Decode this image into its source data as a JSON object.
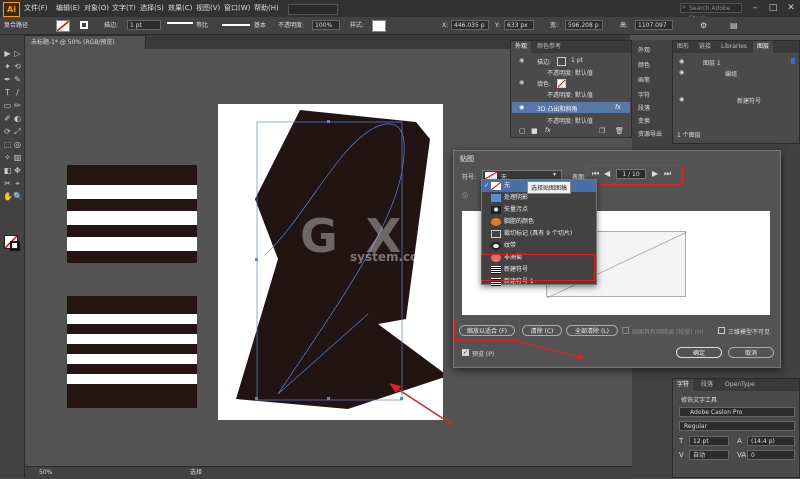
{
  "app": {
    "logo": "Ai"
  },
  "menu": [
    "文件(F)",
    "编辑(E)",
    "对象(O)",
    "文字(T)",
    "选择(S)",
    "效果(C)",
    "视图(V)",
    "窗口(W)",
    "帮助(H)"
  ],
  "search": {
    "placeholder": "Search Adobe Stock"
  },
  "control_bar": {
    "mode": "复合路径",
    "stroke_label": "描边:",
    "stroke_value": "1 pt",
    "stroke_style": "等比",
    "brush_style": "基本",
    "opacity_label": "不透明度:",
    "opacity_value": "100%",
    "style_label": "样式:",
    "x_label": "X:",
    "x_value": "446.035 p",
    "y_label": "Y:",
    "y_value": "633 px",
    "w_label": "宽:",
    "w_value": "596.208 p",
    "h_label": "高:",
    "h_value": "1107.097"
  },
  "document": {
    "tab": "未标题-1* @ 50% (RGB/预览)",
    "zoom": "50%",
    "status": "选择"
  },
  "appearance_panel": {
    "tabs": [
      "外观",
      "颜色参考"
    ],
    "rows": [
      "描边:",
      "1 pt",
      "不透明度: 默认值",
      "填色:",
      "不透明度: 默认值",
      "3D 凸出和斜角",
      "不透明度: 默认值"
    ],
    "fx": "fx"
  },
  "side_icons": [
    "外观",
    "颜色",
    "画笔",
    "字符",
    "段落",
    "变换",
    "资源导出"
  ],
  "layers_panel": {
    "tabs": [
      "图形",
      "链接",
      "Libraries",
      "图层"
    ],
    "rows": [
      "图层 1",
      "编组",
      "新建符号"
    ],
    "footer": "1 个图层"
  },
  "char_panel": {
    "tabs": [
      "字符",
      "段落",
      "OpenType"
    ],
    "touch_tool": "修饰文字工具",
    "font": "Adobe Caslon Pro",
    "style": "Regular",
    "size": "12 pt",
    "leading": "(14.4 p)",
    "kerning": "自动",
    "tracking": "0"
  },
  "dialog": {
    "title": "贴图",
    "symbol_label": "符号:",
    "symbol_value": "无",
    "surface_label": "表面:",
    "surface_value": "1 / 10",
    "tooltip": "选择贴图图稿",
    "dropdown": [
      "无",
      "处理阴影",
      "矢量污点",
      "胭脂的颜色",
      "裁切标记 (具有 9 个切片)",
      "纹带",
      "非洲菊",
      "新建符号",
      "新建符号 1"
    ],
    "scale_btn": "缩放以适合 (F)",
    "clear_btn": "清除 (C)",
    "clear_all_btn": "全部清除 (L)",
    "shade_art": "贴图具有明暗调 (较慢) (H)",
    "invisible_geom": "三维模型不可见",
    "preview": "预览 (P)",
    "ok": "确定",
    "cancel": "取消"
  },
  "watermark": {
    "line1": "G X I 网",
    "line2": "system.com"
  }
}
